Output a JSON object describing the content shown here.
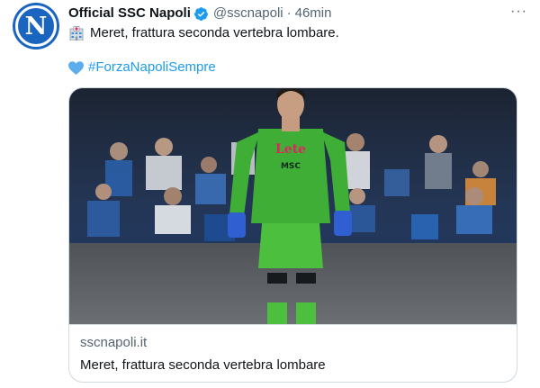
{
  "tweet": {
    "avatar_letter": "N",
    "display_name": "Official SSC Napoli",
    "handle": "@sscnapoli",
    "separator": "·",
    "time": "46min",
    "more_label": "···",
    "text_line1": "Meret, frattura seconda vertebra lombare.",
    "hashtag": "#ForzaNapoliSempre",
    "icons": {
      "line1": "hospital-icon",
      "line2": "blue-heart-icon",
      "badge": "verified-badge-icon"
    }
  },
  "card": {
    "domain": "sscnapoli.it",
    "title": "Meret, frattura seconda vertebra lombare",
    "jersey_sponsor": "Lete",
    "jersey_text": "MSC",
    "image_subject": "goalkeeper-photo"
  },
  "colors": {
    "link": "#1d9bf0",
    "secondary_text": "#536471",
    "border": "#cfd9de",
    "avatar_bg": "#1a65c0",
    "jersey": "#4cbf3f"
  }
}
